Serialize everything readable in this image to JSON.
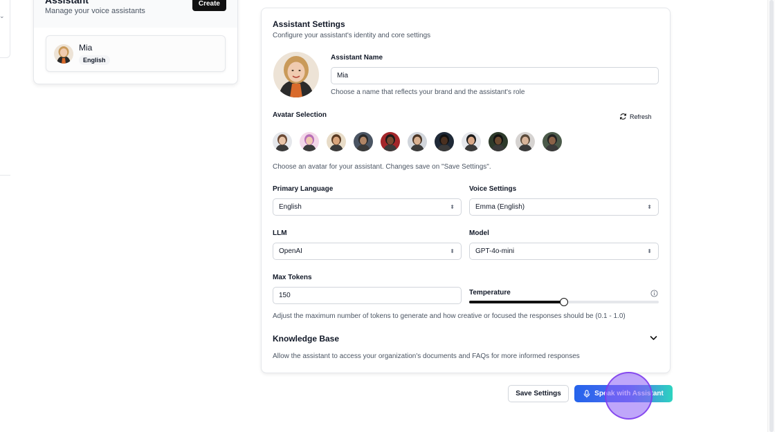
{
  "assistant_list": {
    "title": "Assistant",
    "subtitle": "Manage your voice assistants",
    "create_label": "Create",
    "items": [
      {
        "name": "Mia",
        "language_badge": "English"
      }
    ]
  },
  "settings": {
    "title": "Assistant Settings",
    "subtitle": "Configure your assistant's identity and core settings",
    "name_label": "Assistant Name",
    "name_value": "Mia",
    "name_help": "Choose a name that reflects your brand and the assistant's role",
    "avatar_label": "Avatar Selection",
    "refresh_label": "Refresh",
    "avatar_help": "Choose an avatar for your assistant. Changes save on \"Save Settings\".",
    "primary_language_label": "Primary Language",
    "primary_language_value": "English",
    "voice_label": "Voice Settings",
    "voice_value": "Emma (English)",
    "llm_label": "LLM",
    "llm_value": "OpenAI",
    "model_label": "Model",
    "model_value": "GPT-4o-mini",
    "max_tokens_label": "Max Tokens",
    "max_tokens_value": "150",
    "temperature_label": "Temperature",
    "temperature_fraction": 0.5,
    "tokens_help": "Adjust the maximum number of tokens to generate and how creative or focused the responses should be (0.1 - 1.0)",
    "kb_title": "Knowledge Base",
    "kb_help": "Allow the assistant to access your organization's documents and FAQs for more informed responses"
  },
  "actions": {
    "save_label": "Save Settings",
    "speak_label": "Speak with Assistant"
  },
  "avatars": [
    {
      "skin": "#e8c4a8",
      "hair": "#6b4a36",
      "bg": "#e5e7eb"
    },
    {
      "skin": "#f0c8b0",
      "hair": "#b86fb8",
      "bg": "#f3d7e8"
    },
    {
      "skin": "#d9a57c",
      "hair": "#5a3a22",
      "bg": "#e8dcc8"
    },
    {
      "skin": "#b08566",
      "hair": "#2a2a2a",
      "bg": "#4b5563"
    },
    {
      "skin": "#7a4a32",
      "hair": "#1a1a1a",
      "bg": "#a3262a"
    },
    {
      "skin": "#d8b090",
      "hair": "#4a3526",
      "bg": "#d1d5db"
    },
    {
      "skin": "#4a3020",
      "hair": "#111111",
      "bg": "#1f2937"
    },
    {
      "skin": "#d8a888",
      "hair": "#1c1c1c",
      "bg": "#e5e7eb"
    },
    {
      "skin": "#6b4a30",
      "hair": "#111111",
      "bg": "#2d3a2a"
    },
    {
      "skin": "#d8b49a",
      "hair": "#5a4a3a",
      "bg": "#d6d3d1"
    },
    {
      "skin": "#8a6248",
      "hair": "#222222",
      "bg": "#4b5a4a"
    }
  ],
  "colors": {
    "accent_start": "#2563eb",
    "accent_end": "#2dd4bf",
    "click_highlight": "#8b5cf6"
  },
  "icons": {
    "refresh": "refresh-icon",
    "microphone": "microphone-icon",
    "info": "info-icon",
    "chevron": "chevron-down-icon",
    "select_caret": "updown-caret-icon"
  }
}
